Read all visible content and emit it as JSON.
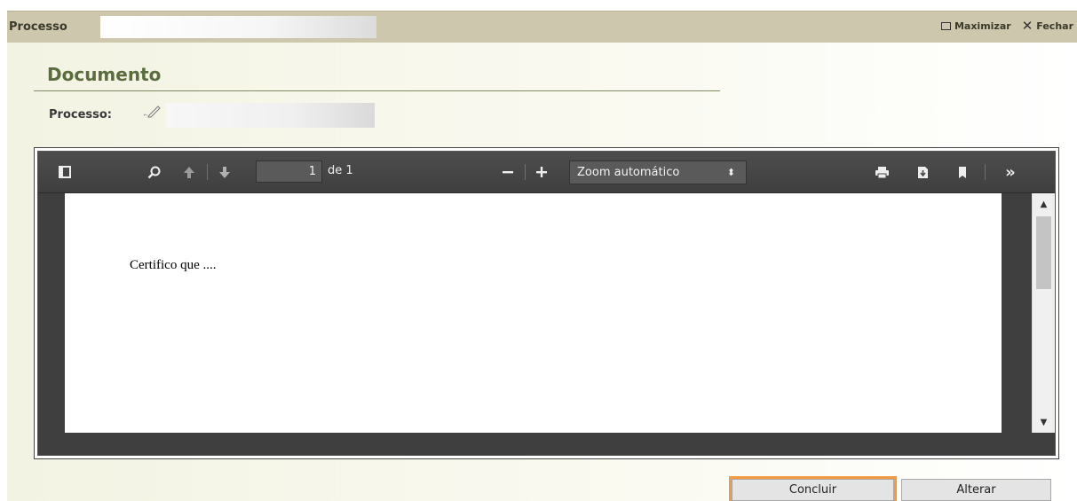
{
  "window": {
    "title": "Processo",
    "maximize_label": "Maximizar",
    "close_label": "Fechar"
  },
  "main": {
    "heading": "Documento",
    "process_label": "Processo:"
  },
  "viewer": {
    "page_number": "1",
    "page_count_label": "de 1",
    "zoom_label": "Zoom automático",
    "document_text": "Certifico que ....",
    "icons": [
      "sidebar-toggle-icon",
      "search-icon",
      "previous-page-icon",
      "next-page-icon",
      "zoom-out-icon",
      "zoom-in-icon",
      "print-icon",
      "download-icon",
      "bookmark-icon",
      "tools-icon"
    ]
  },
  "actions": {
    "conclude_label": "Concluir",
    "change_label": "Alterar"
  },
  "colors": {
    "titlebar": "#cdc8ad",
    "heading": "#5a6b3e",
    "highlight": "#f29a3f",
    "viewer_toolbar": "#474747"
  }
}
